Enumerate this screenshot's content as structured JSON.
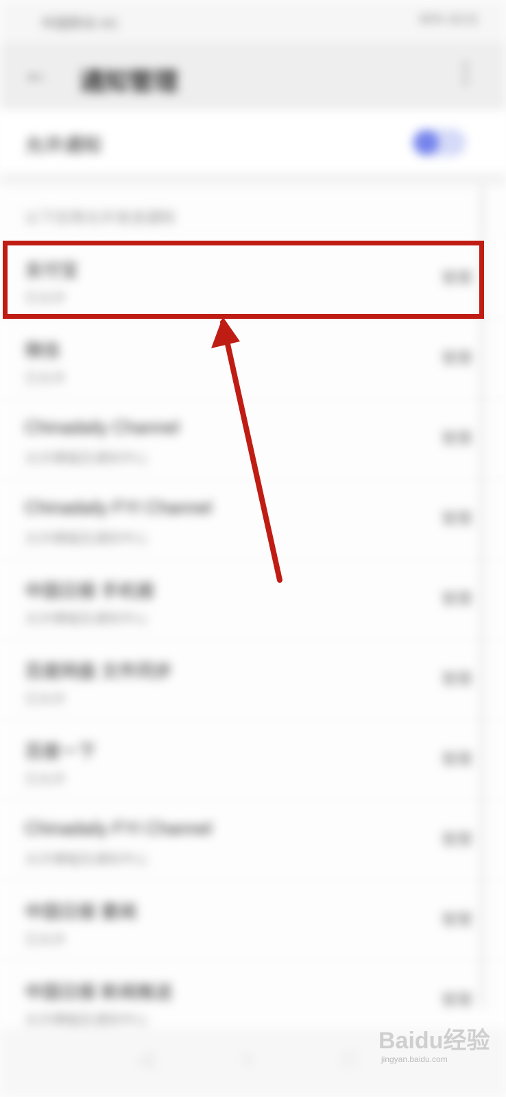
{
  "statusbar": {
    "carrier": "中国移动 4G",
    "right": "92% 10:21"
  },
  "appbar": {
    "back_icon": "arrow-left-icon",
    "title": "通知管理",
    "more_icon": "more-vertical-icon"
  },
  "main_toggle": {
    "label": "允许通知",
    "state": "on",
    "accent": "#7584ec"
  },
  "section_header": "以下应用允许发送通知",
  "items": [
    {
      "name": "支付宝",
      "sub": "已允许",
      "action": "管理"
    },
    {
      "name": "微信",
      "sub": "已允许",
      "action": "管理"
    },
    {
      "name": "Chinadaily Channel",
      "sub": "允许横幅及通知中心",
      "action": "管理"
    },
    {
      "name": "Chinadaily FYI Channel",
      "sub": "允许横幅及通知中心",
      "action": "管理"
    },
    {
      "name": "中国日报 手机报",
      "sub": "允许横幅及通知中心",
      "action": "管理"
    },
    {
      "name": "百度网盘 文件同步",
      "sub": "已允许",
      "action": "管理"
    },
    {
      "name": "百度一下",
      "sub": "已允许",
      "action": "管理"
    },
    {
      "name": "Chinadaily FYI Channel",
      "sub": "允许横幅及通知中心",
      "action": "管理"
    },
    {
      "name": "中国日报 要闻",
      "sub": "已允许",
      "action": "管理"
    },
    {
      "name": "中国日报 新闻推送",
      "sub": "允许横幅及通知中心",
      "action": "管理"
    }
  ],
  "navbar": {
    "back": "◁",
    "home": "○",
    "recent": "□"
  },
  "annotation": {
    "color": "#bf1d14"
  },
  "watermark": {
    "brand": "Baidu经验",
    "url": "jingyan.baidu.com"
  }
}
